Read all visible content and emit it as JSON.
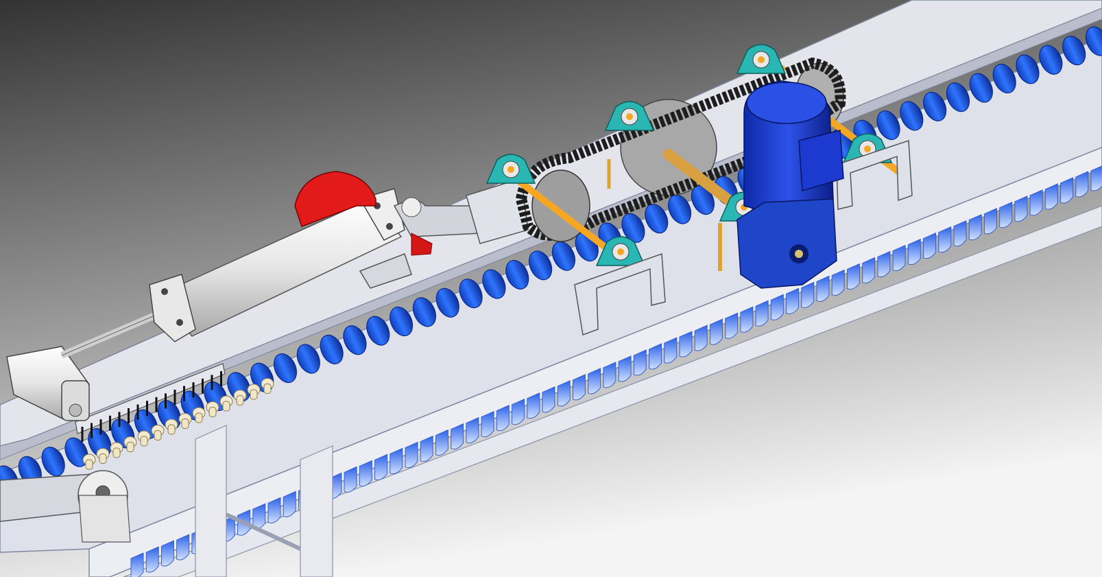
{
  "scene": {
    "description_visible_text": "",
    "colors": {
      "bg_top": "#3b3b3b",
      "bg_bottom": "#f2f2f2",
      "frame": "#e6e7ee",
      "frame_edge": "#9aa0b4",
      "roller_blue": "#1a57e0",
      "roller_light": "#a9c4ff",
      "motor_blue": "#1838c8",
      "bearing_teal": "#2ab7b4",
      "shaft_orange": "#f5a623",
      "cylinder_red": "#e81818",
      "chain": "#222222",
      "sprocket": "#9c9c9c"
    },
    "icons": [
      "conveyor-frame",
      "roller-conveyor",
      "pneumatic-cylinder",
      "red-motor",
      "chain-drive",
      "gear-motor",
      "pillow-block-bearing",
      "sprocket"
    ]
  }
}
